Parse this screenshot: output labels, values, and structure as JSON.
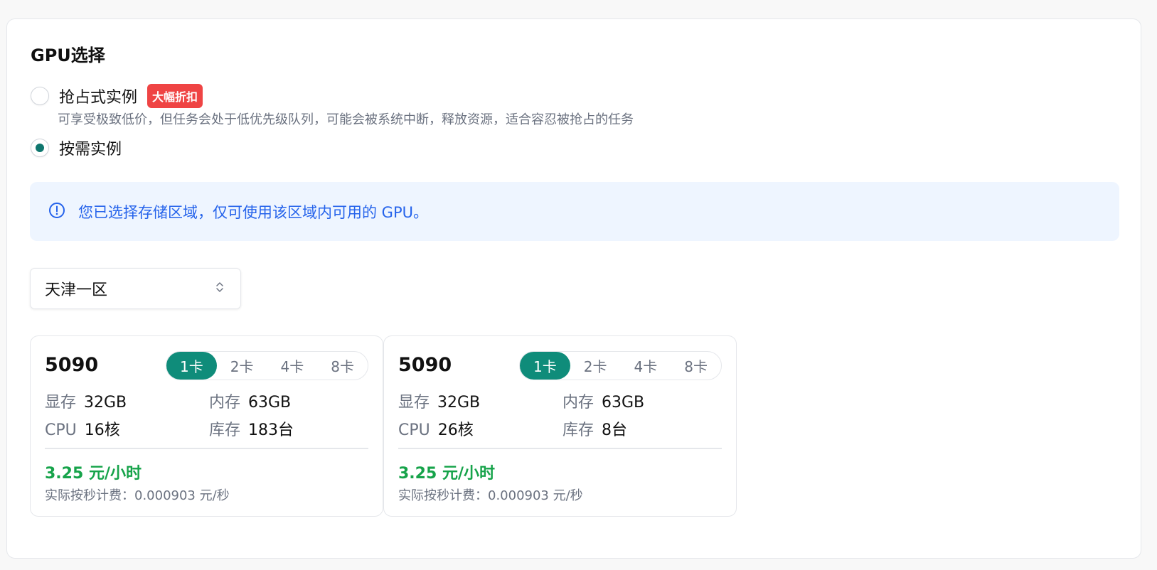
{
  "section": {
    "title": "GPU选择"
  },
  "instance_types": [
    {
      "label": "抢占式实例",
      "badge": "大幅折扣",
      "description": "可享受极致低价，但任务会处于低优先级队列，可能会被系统中断，释放资源，适合容忍被抢占的任务",
      "selected": false
    },
    {
      "label": "按需实例",
      "selected": true
    }
  ],
  "alert": {
    "icon": "info-circle-icon",
    "text": "您已选择存储区域，仅可使用该区域内可用的 GPU。"
  },
  "region_select": {
    "value": "天津一区",
    "icon": "chevron-up-down-icon"
  },
  "gpu_cards": [
    {
      "name": "5090",
      "card_options": [
        "1卡",
        "2卡",
        "4卡",
        "8卡"
      ],
      "selected_option": "1卡",
      "specs": {
        "vram_label": "显存",
        "vram": "32GB",
        "mem_label": "内存",
        "mem": "63GB",
        "cpu_label": "CPU",
        "cpu": "16核",
        "stock_label": "库存",
        "stock": "183台"
      },
      "price": "3.25 元/小时",
      "per_second": "实际按秒计费：0.000903 元/秒"
    },
    {
      "name": "5090",
      "card_options": [
        "1卡",
        "2卡",
        "4卡",
        "8卡"
      ],
      "selected_option": "1卡",
      "specs": {
        "vram_label": "显存",
        "vram": "32GB",
        "mem_label": "内存",
        "mem": "63GB",
        "cpu_label": "CPU",
        "cpu": "26核",
        "stock_label": "库存",
        "stock": "8台"
      },
      "price": "3.25 元/小时",
      "per_second": "实际按秒计费：0.000903 元/秒"
    }
  ],
  "colors": {
    "accent": "#0f8c7a",
    "price": "#16a34a",
    "badge": "#ef4444",
    "alert_text": "#2563eb",
    "alert_bg": "#eef5ff"
  }
}
